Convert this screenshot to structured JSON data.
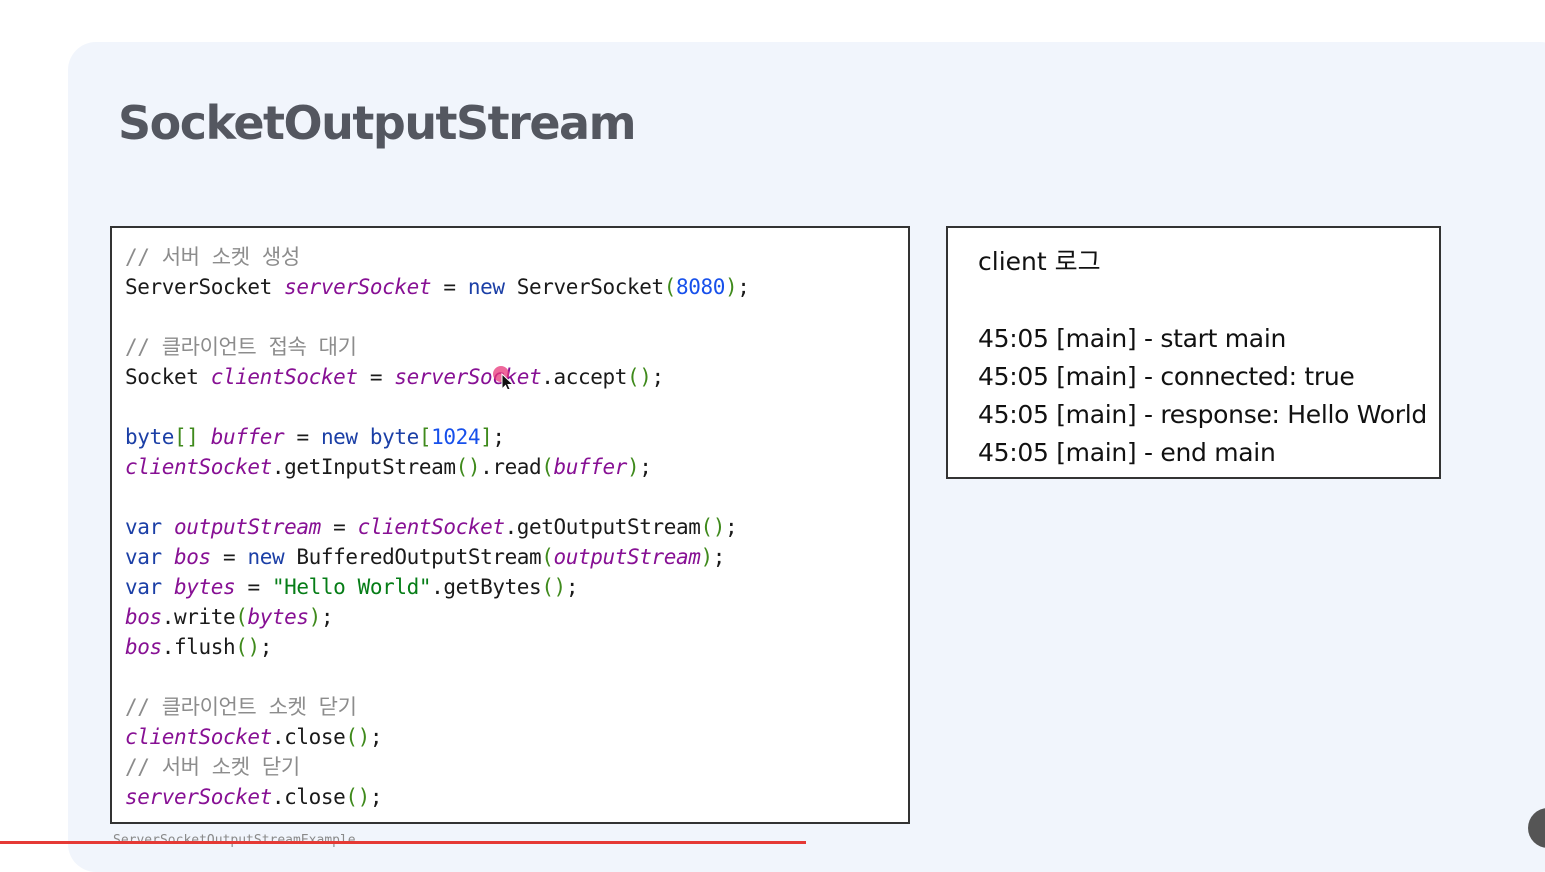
{
  "slide": {
    "title": "SocketOutputStream",
    "caption": "ServerSocketOutputStreamExample"
  },
  "code": {
    "lines": [
      [
        [
          "cm",
          "// 서버 소켓 생성"
        ]
      ],
      [
        [
          "pl",
          "ServerSocket "
        ],
        [
          "it",
          "serverSocket"
        ],
        [
          "pl",
          " = "
        ],
        [
          "kw",
          "new"
        ],
        [
          "pl",
          " ServerSocket"
        ],
        [
          "par",
          "("
        ],
        [
          "num",
          "8080"
        ],
        [
          "par",
          ")"
        ],
        [
          "pl",
          ";"
        ]
      ],
      [],
      [
        [
          "cm",
          "// 클라이언트 접속 대기"
        ]
      ],
      [
        [
          "pl",
          "Socket "
        ],
        [
          "it",
          "clientSocket"
        ],
        [
          "pl",
          " = "
        ],
        [
          "it",
          "serverSocket"
        ],
        [
          "pl",
          ".accept"
        ],
        [
          "par",
          "()"
        ],
        [
          "pl",
          ";"
        ]
      ],
      [],
      [
        [
          "kw",
          "byte"
        ],
        [
          "par",
          "[]"
        ],
        [
          "pl",
          " "
        ],
        [
          "it",
          "buffer"
        ],
        [
          "pl",
          " = "
        ],
        [
          "kw",
          "new"
        ],
        [
          "pl",
          " "
        ],
        [
          "kw",
          "byte"
        ],
        [
          "par",
          "["
        ],
        [
          "num",
          "1024"
        ],
        [
          "par",
          "]"
        ],
        [
          "pl",
          ";"
        ]
      ],
      [
        [
          "it",
          "clientSocket"
        ],
        [
          "pl",
          ".getInputStream"
        ],
        [
          "par",
          "()"
        ],
        [
          "pl",
          ".read"
        ],
        [
          "par",
          "("
        ],
        [
          "it",
          "buffer"
        ],
        [
          "par",
          ")"
        ],
        [
          "pl",
          ";"
        ]
      ],
      [],
      [
        [
          "kw",
          "var"
        ],
        [
          "pl",
          " "
        ],
        [
          "it",
          "outputStream"
        ],
        [
          "pl",
          " = "
        ],
        [
          "it",
          "clientSocket"
        ],
        [
          "pl",
          ".getOutputStream"
        ],
        [
          "par",
          "()"
        ],
        [
          "pl",
          ";"
        ]
      ],
      [
        [
          "kw",
          "var"
        ],
        [
          "pl",
          " "
        ],
        [
          "it",
          "bos"
        ],
        [
          "pl",
          " = "
        ],
        [
          "kw",
          "new"
        ],
        [
          "pl",
          " BufferedOutputStream"
        ],
        [
          "par",
          "("
        ],
        [
          "it",
          "outputStream"
        ],
        [
          "par",
          ")"
        ],
        [
          "pl",
          ";"
        ]
      ],
      [
        [
          "kw",
          "var"
        ],
        [
          "pl",
          " "
        ],
        [
          "it",
          "bytes"
        ],
        [
          "pl",
          " = "
        ],
        [
          "str",
          "\"Hello World\""
        ],
        [
          "pl",
          ".getBytes"
        ],
        [
          "par",
          "()"
        ],
        [
          "pl",
          ";"
        ]
      ],
      [
        [
          "it",
          "bos"
        ],
        [
          "pl",
          ".write"
        ],
        [
          "par",
          "("
        ],
        [
          "it",
          "bytes"
        ],
        [
          "par",
          ")"
        ],
        [
          "pl",
          ";"
        ]
      ],
      [
        [
          "it",
          "bos"
        ],
        [
          "pl",
          ".flush"
        ],
        [
          "par",
          "()"
        ],
        [
          "pl",
          ";"
        ]
      ],
      [],
      [
        [
          "cm",
          "// 클라이언트 소켓 닫기"
        ]
      ],
      [
        [
          "it",
          "clientSocket"
        ],
        [
          "pl",
          ".close"
        ],
        [
          "par",
          "()"
        ],
        [
          "pl",
          ";"
        ]
      ],
      [
        [
          "cm",
          "// 서버 소켓 닫기"
        ]
      ],
      [
        [
          "it",
          "serverSocket"
        ],
        [
          "pl",
          ".close"
        ],
        [
          "par",
          "()"
        ],
        [
          "pl",
          ";"
        ]
      ]
    ]
  },
  "log": {
    "title": "client 로그",
    "lines": [
      "45:05 [main] - start main",
      "45:05 [main] - connected: true",
      "45:05 [main] - response: Hello World",
      "45:05 [main] - end main"
    ]
  },
  "colors": {
    "keyword": "#1b3fa6",
    "variable_italic": "#871094",
    "number": "#1750eb",
    "parenthesis": "#3f8a1c",
    "string": "#067d17",
    "comment": "#8c8c8c",
    "progress": "#e53935"
  },
  "icons": {
    "cursor": "mouse-pointer-icon"
  }
}
